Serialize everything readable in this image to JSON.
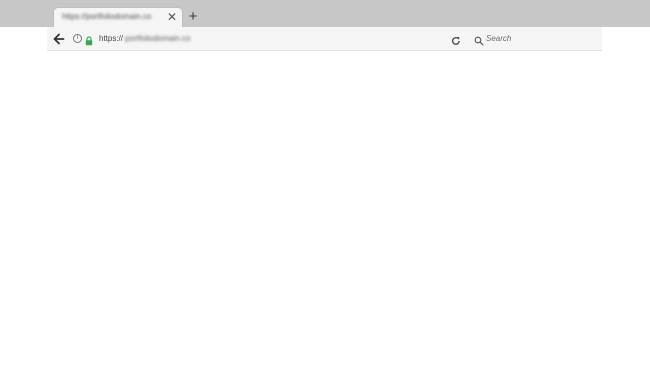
{
  "browser": {
    "tab": {
      "title": "https://portfoliodomain.co",
      "close_symbol": "✕"
    },
    "new_tab_symbol": "+",
    "address_bar": {
      "scheme": "https://",
      "host": "portfoliodomain.co",
      "info_symbol": "i"
    },
    "search": {
      "placeholder": "Search"
    }
  },
  "colors": {
    "tabstrip": "#c7c7c7",
    "toolbar": "#f5f5f5",
    "lock": "#3aa757",
    "page": "#ffffff"
  },
  "icons": [
    "back-arrow-icon",
    "info-icon",
    "lock-icon",
    "reload-icon",
    "search-icon",
    "close-icon",
    "plus-icon"
  ]
}
